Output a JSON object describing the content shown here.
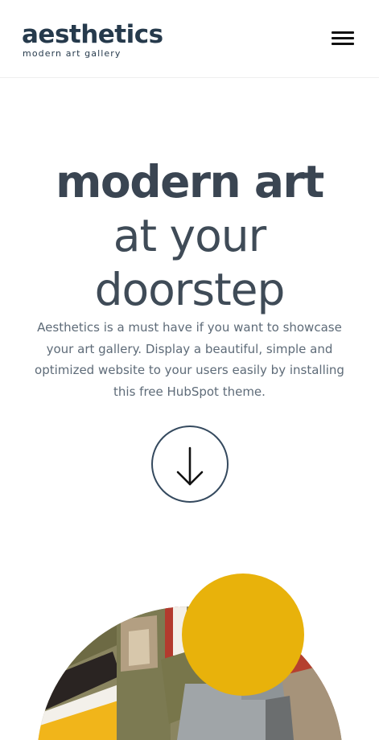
{
  "brand": {
    "name": "aesthetics",
    "tagline": "modern art gallery"
  },
  "header": {
    "menu_icon": "hamburger-menu-icon"
  },
  "hero": {
    "title_bold": "modern art",
    "title_line2": "at your",
    "title_line3": "doorstep",
    "description": "Aesthetics is a must have if you want to showcase your art gallery. Display a beautiful, simple and optimized website to your users easily by installing this free HubSpot theme.",
    "scroll_icon": "arrow-down-icon"
  },
  "colors": {
    "primary": "#34495e",
    "text": "#5e6b78",
    "accent_yellow": "#e8b20b",
    "art_red": "#b33a2e",
    "art_olive": "#7e7c4e",
    "art_gray": "#9aa0a2"
  }
}
